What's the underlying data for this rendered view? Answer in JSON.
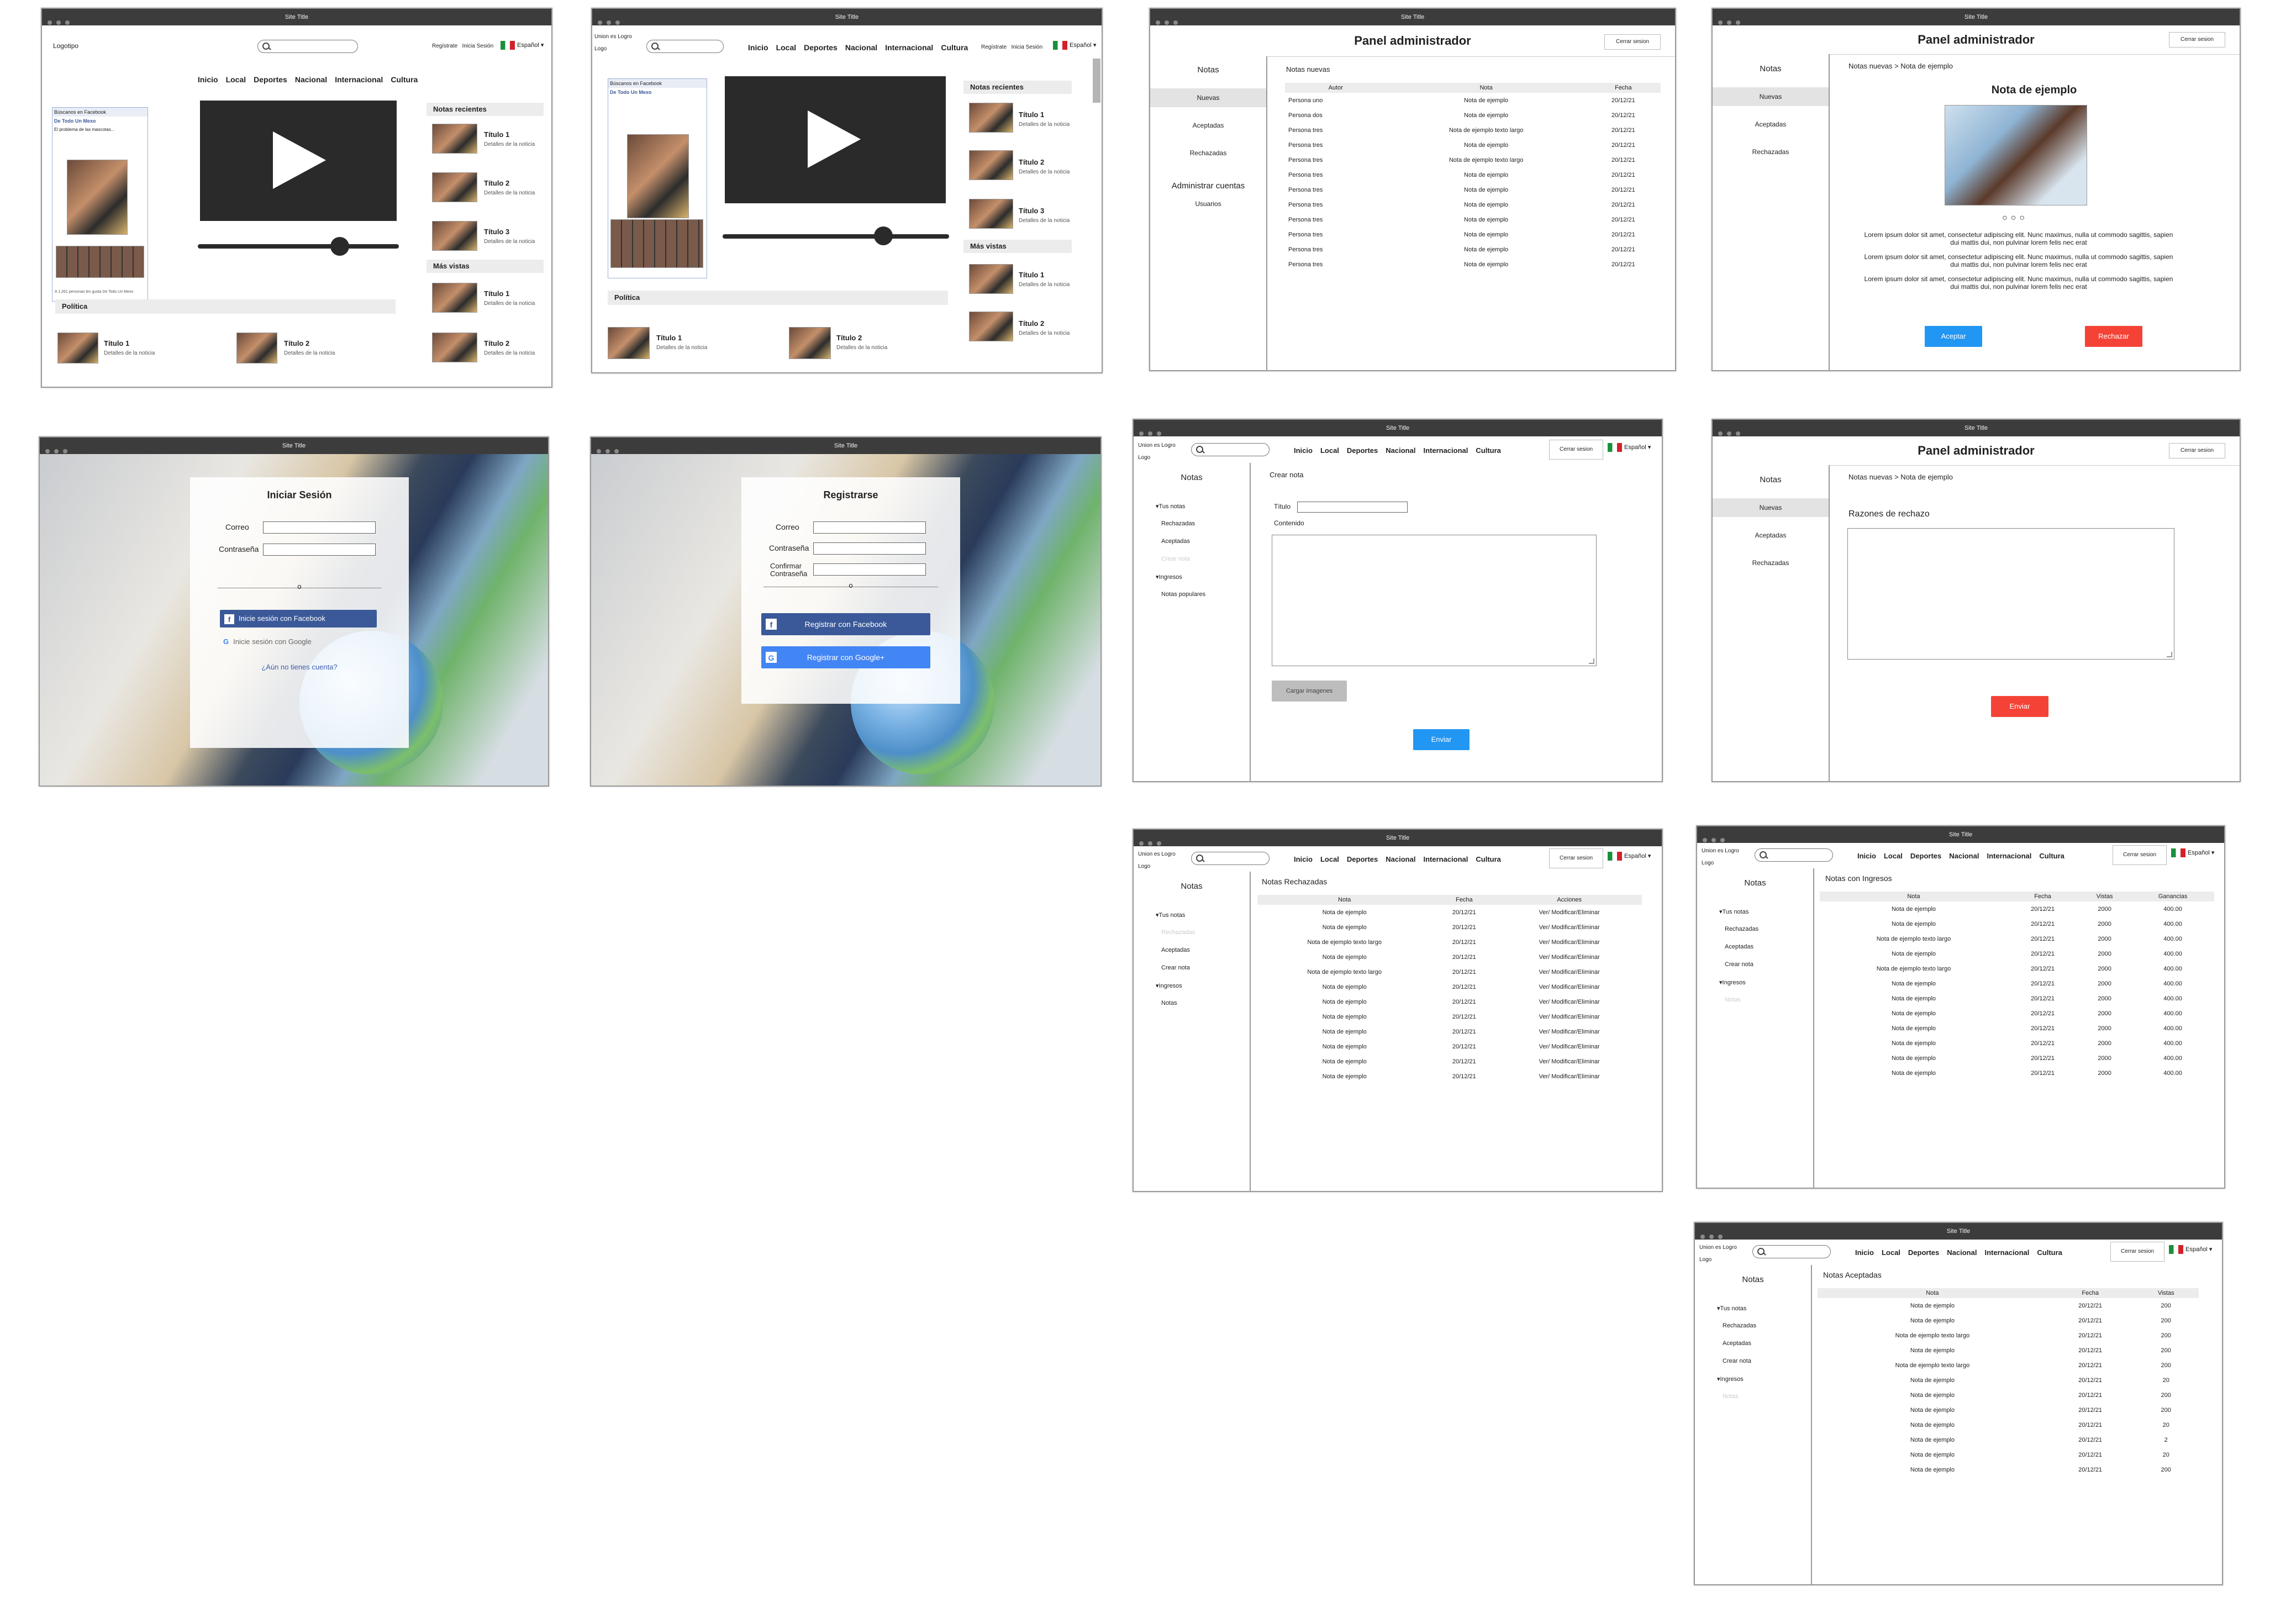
{
  "site_title": "Site Title",
  "nav": [
    "Inicio",
    "Local",
    "Deportes",
    "Nacional",
    "Internacional",
    "Cultura"
  ],
  "lang": "Español",
  "home1": {
    "logo": "Logotipo",
    "auth_links": "Regístrate   Inicia Sesión",
    "fb_title": "Búscanos en Facebook",
    "fb_page": "De Todo Un Mexo",
    "fb_post": "El problema de las mascotas...",
    "fb_footer": "A 1,261 personas les gusta De Todo Un Mexo",
    "recent_head": "Notas recientes",
    "recent": [
      {
        "title": "Título 1",
        "detail": "Detalles de la noticia"
      },
      {
        "title": "Título 2",
        "detail": "Detalles de la noticia"
      },
      {
        "title": "Título 3",
        "detail": "Detalles de la noticia"
      }
    ],
    "most_head": "Más vistas",
    "most": [
      {
        "title": "Título 1",
        "detail": "Detalles de la noticia"
      },
      {
        "title": "Título 2",
        "detail": "Detalles de la noticia"
      }
    ],
    "section": "Política",
    "bottom": [
      {
        "title": "Título 1",
        "detail": "Detalles de la noticia"
      },
      {
        "title": "Título 2",
        "detail": "Detalles de la noticia"
      }
    ]
  },
  "home2": {
    "logo": "Union es Logro\nLogo",
    "auth_links": "Regístrate   Inicia Sesión"
  },
  "admin_list": {
    "title": "Panel administrador",
    "logout": "Cerrar sesion",
    "side": [
      "Notas",
      "Nuevas",
      "Aceptadas",
      "Rechazadas",
      "Administrar cuentas",
      "Usuarios"
    ],
    "heading": "Notas nuevas",
    "cols": [
      "Autor",
      "Nota",
      "Fecha"
    ],
    "rows": [
      [
        "Persona uno",
        "Nota de ejemplo",
        "20/12/21"
      ],
      [
        "Persona dos",
        "Nota de ejemplo",
        "20/12/21"
      ],
      [
        "Persona tres",
        "Nota de ejemplo texto largo",
        "20/12/21"
      ],
      [
        "Persona tres",
        "Nota de ejemplo",
        "20/12/21"
      ],
      [
        "Persona tres",
        "Nota de ejemplo texto largo",
        "20/12/21"
      ],
      [
        "Persona tres",
        "Nota de ejemplo",
        "20/12/21"
      ],
      [
        "Persona tres",
        "Nota de ejemplo",
        "20/12/21"
      ],
      [
        "Persona tres",
        "Nota de ejemplo",
        "20/12/21"
      ],
      [
        "Persona tres",
        "Nota de ejemplo",
        "20/12/21"
      ],
      [
        "Persona tres",
        "Nota de ejemplo",
        "20/12/21"
      ],
      [
        "Persona tres",
        "Nota de ejemplo",
        "20/12/21"
      ],
      [
        "Persona tres",
        "Nota de ejemplo",
        "20/12/21"
      ]
    ]
  },
  "admin_detail": {
    "breadcrumb": "Notas nuevas > Nota de ejemplo",
    "note_title": "Nota de ejemplo",
    "para": "Lorem ipsum dolor sit amet, consectetur adipiscing elit. Nunc maximus, nulla ut commodo sagittis, sapien dui mattis dui, non pulvinar lorem felis nec erat",
    "accept": "Aceptar",
    "reject": "Rechazar",
    "side": [
      "Notas",
      "Nuevas",
      "Aceptadas",
      "Rechazadas"
    ]
  },
  "login": {
    "title": "Iniciar Sesión",
    "email": "Correo",
    "password": "Contraseña",
    "or": "o",
    "facebook": "Inicie sesión con Facebook",
    "google": "Inicie sesión con Google",
    "no_account": "¿Aún no tienes cuenta?"
  },
  "register": {
    "title": "Registrarse",
    "email": "Correo",
    "password": "Contraseña",
    "confirm": "Confirmar Contraseña",
    "or": "o",
    "facebook": "Registrar con Facebook",
    "google": "Registrar con Google+"
  },
  "create": {
    "logo": "Union es Logro\nLogo",
    "logout": "Cerrar sesion",
    "side_title": "Notas",
    "side": [
      "Tus notas",
      "Rechazadas",
      "Aceptadas",
      "Crear nota",
      "Ingresos",
      "Notas populares"
    ],
    "heading": "Crear nota",
    "title_label": "Título",
    "content_label": "Contenido",
    "upload": "Cargar imagenes",
    "send": "Enviar"
  },
  "reject_form": {
    "title": "Panel administrador",
    "logout": "Cerrar sesion",
    "breadcrumb": "Notas nuevas > Nota de ejemplo",
    "reasons": "Razones de rechazo",
    "send": "Enviar",
    "side": [
      "Notas",
      "Nuevas",
      "Aceptadas",
      "Rechazadas"
    ]
  },
  "rejected": {
    "logo": "Union es Logro\nLogo",
    "logout": "Cerrar sesion",
    "side_title": "Notas",
    "side": [
      "Tus notas",
      "Rechazadas",
      "Aceptadas",
      "Crear nota",
      "Ingresos",
      "Notas"
    ],
    "heading": "Notas Rechazadas",
    "cols": [
      "Nota",
      "Fecha",
      "Acciones"
    ],
    "rows": [
      [
        "Nota de ejemplo",
        "20/12/21",
        "Ver/ Modificar/Eliminar"
      ],
      [
        "Nota de ejemplo",
        "20/12/21",
        "Ver/ Modificar/Eliminar"
      ],
      [
        "Nota de ejemplo texto largo",
        "20/12/21",
        "Ver/ Modificar/Eliminar"
      ],
      [
        "Nota de ejemplo",
        "20/12/21",
        "Ver/ Modificar/Eliminar"
      ],
      [
        "Nota de ejemplo texto largo",
        "20/12/21",
        "Ver/ Modificar/Eliminar"
      ],
      [
        "Nota de ejemplo",
        "20/12/21",
        "Ver/ Modificar/Eliminar"
      ],
      [
        "Nota de ejemplo",
        "20/12/21",
        "Ver/ Modificar/Eliminar"
      ],
      [
        "Nota de ejemplo",
        "20/12/21",
        "Ver/ Modificar/Eliminar"
      ],
      [
        "Nota de ejemplo",
        "20/12/21",
        "Ver/ Modificar/Eliminar"
      ],
      [
        "Nota de ejemplo",
        "20/12/21",
        "Ver/ Modificar/Eliminar"
      ],
      [
        "Nota de ejemplo",
        "20/12/21",
        "Ver/ Modificar/Eliminar"
      ],
      [
        "Nota de ejemplo",
        "20/12/21",
        "Ver/ Modificar/Eliminar"
      ]
    ]
  },
  "income": {
    "logo": "Union es Logro\nLogo",
    "logout": "Cerrar sesion",
    "side_title": "Notas",
    "side": [
      "Tus notas",
      "Rechazadas",
      "Aceptadas",
      "Crear nota",
      "Ingresos",
      "Notas"
    ],
    "heading": "Notas con Ingresos",
    "cols": [
      "Nota",
      "Fecha",
      "Vistas",
      "Ganancias"
    ],
    "rows": [
      [
        "Nota de ejemplo",
        "20/12/21",
        "2000",
        "400.00"
      ],
      [
        "Nota de ejemplo",
        "20/12/21",
        "2000",
        "400.00"
      ],
      [
        "Nota de ejemplo texto largo",
        "20/12/21",
        "2000",
        "400.00"
      ],
      [
        "Nota de ejemplo",
        "20/12/21",
        "2000",
        "400.00"
      ],
      [
        "Nota de ejemplo texto largo",
        "20/12/21",
        "2000",
        "400.00"
      ],
      [
        "Nota de ejemplo",
        "20/12/21",
        "2000",
        "400.00"
      ],
      [
        "Nota de ejemplo",
        "20/12/21",
        "2000",
        "400.00"
      ],
      [
        "Nota de ejemplo",
        "20/12/21",
        "2000",
        "400.00"
      ],
      [
        "Nota de ejemplo",
        "20/12/21",
        "2000",
        "400.00"
      ],
      [
        "Nota de ejemplo",
        "20/12/21",
        "2000",
        "400.00"
      ],
      [
        "Nota de ejemplo",
        "20/12/21",
        "2000",
        "400.00"
      ],
      [
        "Nota de ejemplo",
        "20/12/21",
        "2000",
        "400.00"
      ]
    ]
  },
  "accepted": {
    "logo": "Union es Logro\nLogo",
    "logout": "Cerrar sesion",
    "side_title": "Notas",
    "side": [
      "Tus notas",
      "Rechazadas",
      "Aceptadas",
      "Crear nota",
      "Ingresos",
      "Notas"
    ],
    "heading": "Notas Aceptadas",
    "cols": [
      "Nota",
      "Fecha",
      "Vistas"
    ],
    "rows": [
      [
        "Nota de ejemplo",
        "20/12/21",
        "200"
      ],
      [
        "Nota de ejemplo",
        "20/12/21",
        "200"
      ],
      [
        "Nota de ejemplo texto largo",
        "20/12/21",
        "200"
      ],
      [
        "Nota de ejemplo",
        "20/12/21",
        "200"
      ],
      [
        "Nota de ejemplo texto largo",
        "20/12/21",
        "200"
      ],
      [
        "Nota de ejemplo",
        "20/12/21",
        "20"
      ],
      [
        "Nota de ejemplo",
        "20/12/21",
        "200"
      ],
      [
        "Nota de ejemplo",
        "20/12/21",
        "200"
      ],
      [
        "Nota de ejemplo",
        "20/12/21",
        "20"
      ],
      [
        "Nota de ejemplo",
        "20/12/21",
        "2"
      ],
      [
        "Nota de ejemplo",
        "20/12/21",
        "20"
      ],
      [
        "Nota de ejemplo",
        "20/12/21",
        "200"
      ]
    ]
  },
  "colors": {
    "accept": "#2196f3",
    "reject": "#f44336",
    "titlebar": "#3c3c3c",
    "facebook": "#3b5998",
    "google": "#4285f4"
  }
}
